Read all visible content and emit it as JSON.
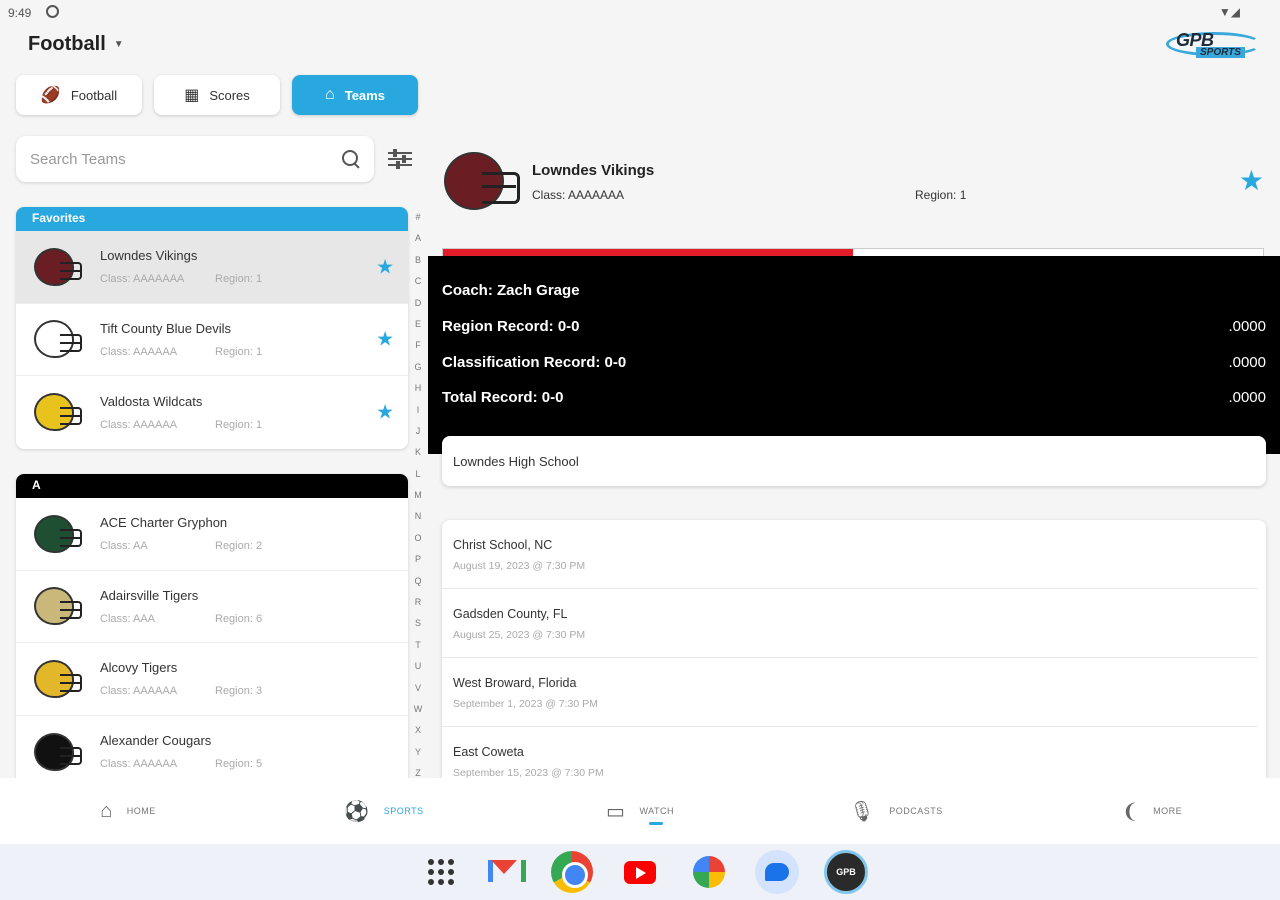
{
  "status": {
    "time": "9:49",
    "system_icons": "▼◢"
  },
  "header": {
    "sport_title": "Football",
    "brand": {
      "text": "GPB",
      "sub": "SPORTS"
    }
  },
  "tabs": [
    {
      "label": "Football",
      "icon": "football-icon"
    },
    {
      "label": "Scores",
      "icon": "scoreboard-icon"
    },
    {
      "label": "Teams",
      "icon": "home-team-icon"
    }
  ],
  "search": {
    "placeholder": "Search Teams"
  },
  "favorites": {
    "title": "Favorites",
    "teams": [
      {
        "name": "Lowndes Vikings",
        "class": "Class: AAAAAAA",
        "region": "Region: 1",
        "color": "#6a1e24"
      },
      {
        "name": "Tift County Blue Devils",
        "class": "Class: AAAAAA",
        "region": "Region: 1",
        "color": "#ffffff"
      },
      {
        "name": "Valdosta Wildcats",
        "class": "Class: AAAAAA",
        "region": "Region: 1",
        "color": "#e8c21d"
      }
    ]
  },
  "section_a": {
    "title": "A",
    "teams": [
      {
        "name": "ACE Charter Gryphon",
        "class": "Class: AA",
        "region": "Region: 2",
        "color": "#1f4f32"
      },
      {
        "name": "Adairsville Tigers",
        "class": "Class: AAA",
        "region": "Region: 6",
        "color": "#c9b87a"
      },
      {
        "name": "Alcovy Tigers",
        "class": "Class: AAAAAA",
        "region": "Region: 3",
        "color": "#e3b72a"
      },
      {
        "name": "Alexander Cougars",
        "class": "Class: AAAAAA",
        "region": "Region: 5",
        "color": "#111111"
      }
    ]
  },
  "alpha_index": [
    "#",
    "A",
    "B",
    "C",
    "D",
    "E",
    "F",
    "G",
    "H",
    "I",
    "J",
    "K",
    "L",
    "M",
    "N",
    "O",
    "P",
    "Q",
    "R",
    "S",
    "T",
    "U",
    "V",
    "W",
    "X",
    "Y",
    "Z"
  ],
  "detail": {
    "name": "Lowndes Vikings",
    "class": "Class: AAAAAAA",
    "region": "Region: 1",
    "progress_fraction": 0.5,
    "coach": "Coach: Zach Grage",
    "records": [
      {
        "label": "Region Record: 0-0",
        "pct": ".0000"
      },
      {
        "label": "Classification Record: 0-0",
        "pct": ".0000"
      },
      {
        "label": "Total Record: 0-0",
        "pct": ".0000"
      }
    ],
    "school": "Lowndes High School",
    "schedule": [
      {
        "opponent": "Christ School, NC",
        "date": "August 19, 2023 @ 7:30 PM"
      },
      {
        "opponent": "Gadsden County, FL",
        "date": "August 25, 2023 @ 7:30 PM"
      },
      {
        "opponent": "West Broward, Florida",
        "date": "September 1, 2023 @ 7:30 PM"
      },
      {
        "opponent": "East Coweta",
        "date": "September 15, 2023 @ 7:30 PM"
      }
    ]
  },
  "nav": [
    {
      "label": "Home",
      "icon": "home-icon"
    },
    {
      "label": "Sports",
      "icon": "sports-icon"
    },
    {
      "label": "Watch",
      "icon": "watch-icon"
    },
    {
      "label": "Podcasts",
      "icon": "microphone-icon"
    },
    {
      "label": "More",
      "icon": "more-icon"
    }
  ],
  "dock_apps": [
    "app-drawer",
    "gmail",
    "chrome",
    "youtube",
    "photos",
    "messages",
    "gpb-sports"
  ]
}
